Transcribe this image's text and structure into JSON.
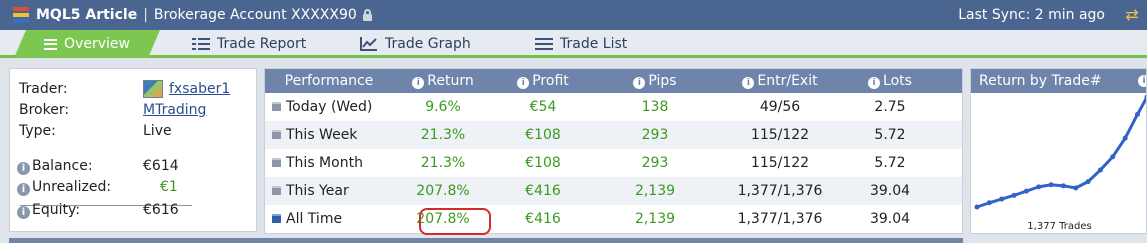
{
  "app": {
    "title": "MQL5 Article",
    "separator": "|",
    "subtitle": "Brokerage Account XXXXX90",
    "last_sync": "Last Sync: 2 min ago",
    "logo_colors": [
      "#e04a3b",
      "#f0c23c",
      "#3b6fc0"
    ]
  },
  "tabs": [
    {
      "label": "Overview",
      "icon": "list-icon",
      "active": true
    },
    {
      "label": "Trade Report",
      "icon": "report-icon",
      "active": false
    },
    {
      "label": "Trade Graph",
      "icon": "line-graph-icon",
      "active": false
    },
    {
      "label": "Trade List",
      "icon": "list-lines-icon",
      "active": false
    }
  ],
  "account": {
    "trader_label": "Trader:",
    "trader_value": "fxsaber1",
    "broker_label": "Broker:",
    "broker_value": "MTrading",
    "type_label": "Type:",
    "type_value": "Live",
    "balance_label": "Balance:",
    "balance_value": "€614",
    "unrealized_label": "Unrealized:",
    "unrealized_value": "€1",
    "equity_label": "Equity:",
    "equity_value": "€616"
  },
  "performance": {
    "headers": [
      "Performance",
      "Return",
      "Profit",
      "Pips",
      "Entr/Exit",
      "Lots"
    ],
    "rows": [
      {
        "period": "Today (Wed)",
        "return": "9.6%",
        "profit": "€54",
        "pips": "138",
        "entr_exit": "49/56",
        "lots": "2.75"
      },
      {
        "period": "This Week",
        "return": "21.3%",
        "profit": "€108",
        "pips": "293",
        "entr_exit": "115/122",
        "lots": "5.72"
      },
      {
        "period": "This Month",
        "return": "21.3%",
        "profit": "€108",
        "pips": "293",
        "entr_exit": "115/122",
        "lots": "5.72"
      },
      {
        "period": "This Year",
        "return": "207.8%",
        "profit": "€416",
        "pips": "2,139",
        "entr_exit": "1,377/1,376",
        "lots": "39.04"
      },
      {
        "period": "All Time",
        "return": "207.8%",
        "profit": "€416",
        "pips": "2,139",
        "entr_exit": "1,377/1,376",
        "lots": "39.04"
      }
    ]
  },
  "mini_chart": {
    "title": "Return by Trade#",
    "footer": "1,377 Trades",
    "line_color": "#2f63c7",
    "chart_data": {
      "type": "line",
      "title": "Return by Trade#",
      "xlabel": "1,377 Trades",
      "x": [
        0,
        100,
        200,
        300,
        400,
        500,
        600,
        700,
        800,
        900,
        1000,
        1100,
        1200,
        1300,
        1377
      ],
      "values": [
        0,
        8,
        15,
        22,
        30,
        38,
        42,
        40,
        36,
        48,
        70,
        95,
        130,
        175,
        207.8
      ]
    }
  }
}
